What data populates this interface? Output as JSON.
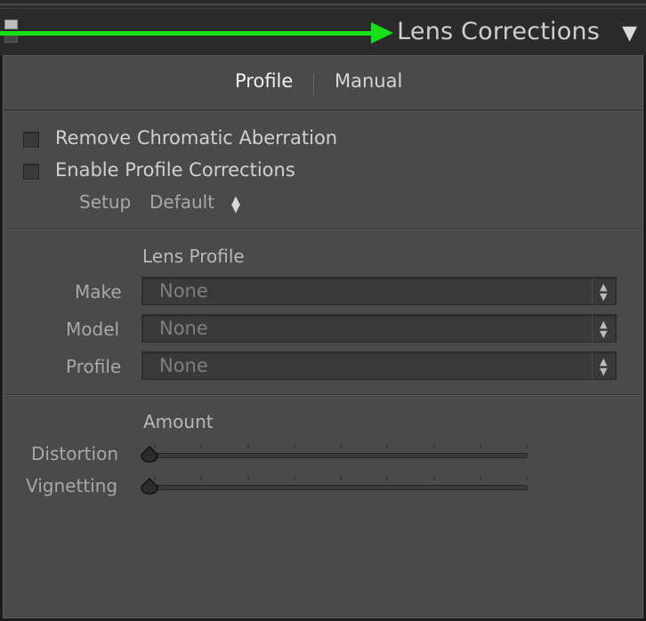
{
  "header": {
    "title": "Lens Corrections",
    "collapse_glyph": "▼",
    "arrow_color": "#16e016"
  },
  "tabs": [
    {
      "label": "Profile",
      "active": true
    },
    {
      "label": "Manual",
      "active": false
    }
  ],
  "options": {
    "remove_ca": {
      "label": "Remove Chromatic Aberration",
      "checked": false
    },
    "enable_profile": {
      "label": "Enable Profile Corrections",
      "checked": false
    },
    "setup": {
      "label": "Setup",
      "value": "Default"
    }
  },
  "lens_profile": {
    "title": "Lens Profile",
    "fields": [
      {
        "label": "Make",
        "value": "None"
      },
      {
        "label": "Model",
        "value": "None"
      },
      {
        "label": "Profile",
        "value": "None"
      }
    ]
  },
  "amount": {
    "title": "Amount",
    "sliders": [
      {
        "label": "Distortion",
        "value": 0
      },
      {
        "label": "Vignetting",
        "value": 0
      }
    ]
  },
  "icons": {
    "collapse": "triangle-down-icon",
    "stepper": "up-down-arrows-icon",
    "arrow": "green-arrow-right-icon"
  }
}
